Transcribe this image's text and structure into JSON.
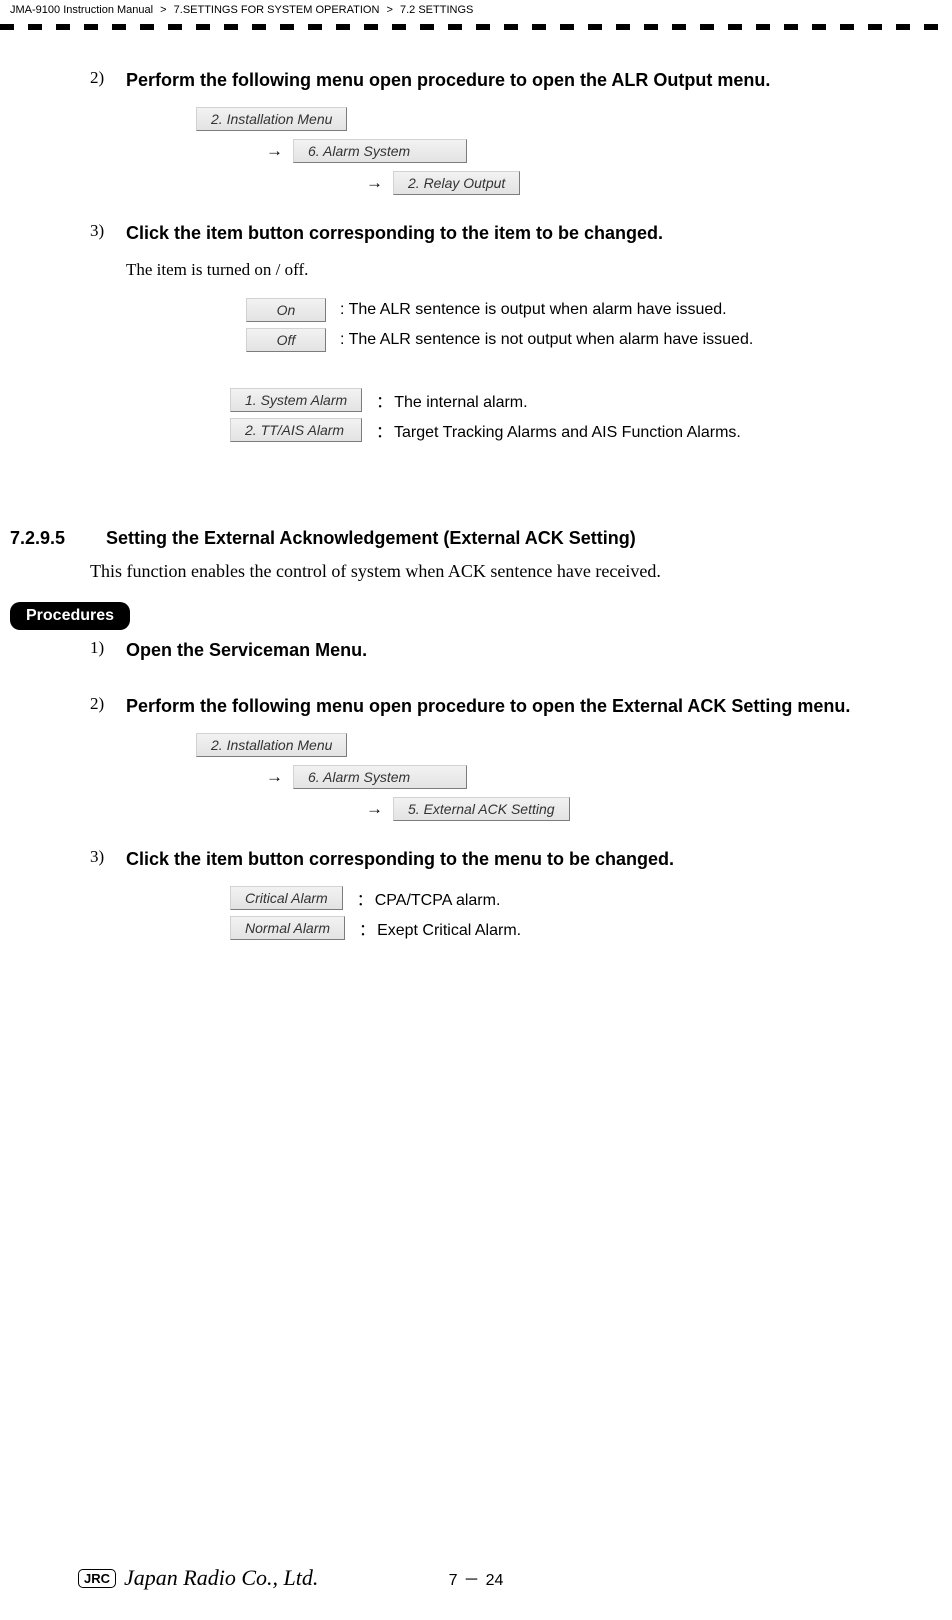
{
  "header": {
    "manual": "JMA-9100 Instruction Manual",
    "chapter": "7.SETTINGS FOR SYSTEM OPERATION",
    "section": "7.2  SETTINGS"
  },
  "steps": {
    "s2": {
      "num": "2)",
      "title": "Perform the following menu open procedure to open the ALR Output menu.",
      "menu1": "2. Installation Menu",
      "menu2": "6. Alarm System",
      "menu3": "2. Relay Output"
    },
    "s3": {
      "num": "3)",
      "title": "Click the item button corresponding to the item to be changed.",
      "note": "The item is turned on / off.",
      "opts": {
        "on_label": "On",
        "on_desc": ": The ALR sentence is output when alarm have issued.",
        "off_label": "Off",
        "off_desc": ": The ALR sentence is not output when alarm have issued.",
        "sys_label": "1. System Alarm",
        "sys_desc": "The internal alarm.",
        "tt_label": "2. TT/AIS Alarm",
        "tt_desc": "Target Tracking Alarms and AIS Function Alarms."
      }
    }
  },
  "section": {
    "num": "7.2.9.5",
    "title": "Setting the External Acknowledgement (External ACK Setting)",
    "desc": "This function enables the control of system when ACK sentence have received.",
    "procedures": "Procedures",
    "p1": {
      "num": "1)",
      "title": "Open the Serviceman Menu."
    },
    "p2": {
      "num": "2)",
      "title": "Perform the following menu open procedure to open the External ACK Setting menu.",
      "menu1": "2. Installation Menu",
      "menu2": "6. Alarm System",
      "menu3": "5. External ACK Setting"
    },
    "p3": {
      "num": "3)",
      "title": "Click the item button corresponding to the menu to be changed.",
      "crit_label": "Critical Alarm",
      "crit_desc": "CPA/TCPA alarm.",
      "norm_label": "Normal Alarm",
      "norm_desc": "Exept Critical Alarm."
    }
  },
  "footer": {
    "jrc": "JRC",
    "company": "Japan Radio Co., Ltd.",
    "chapter_page": "7",
    "dash": "－",
    "page": "24"
  }
}
